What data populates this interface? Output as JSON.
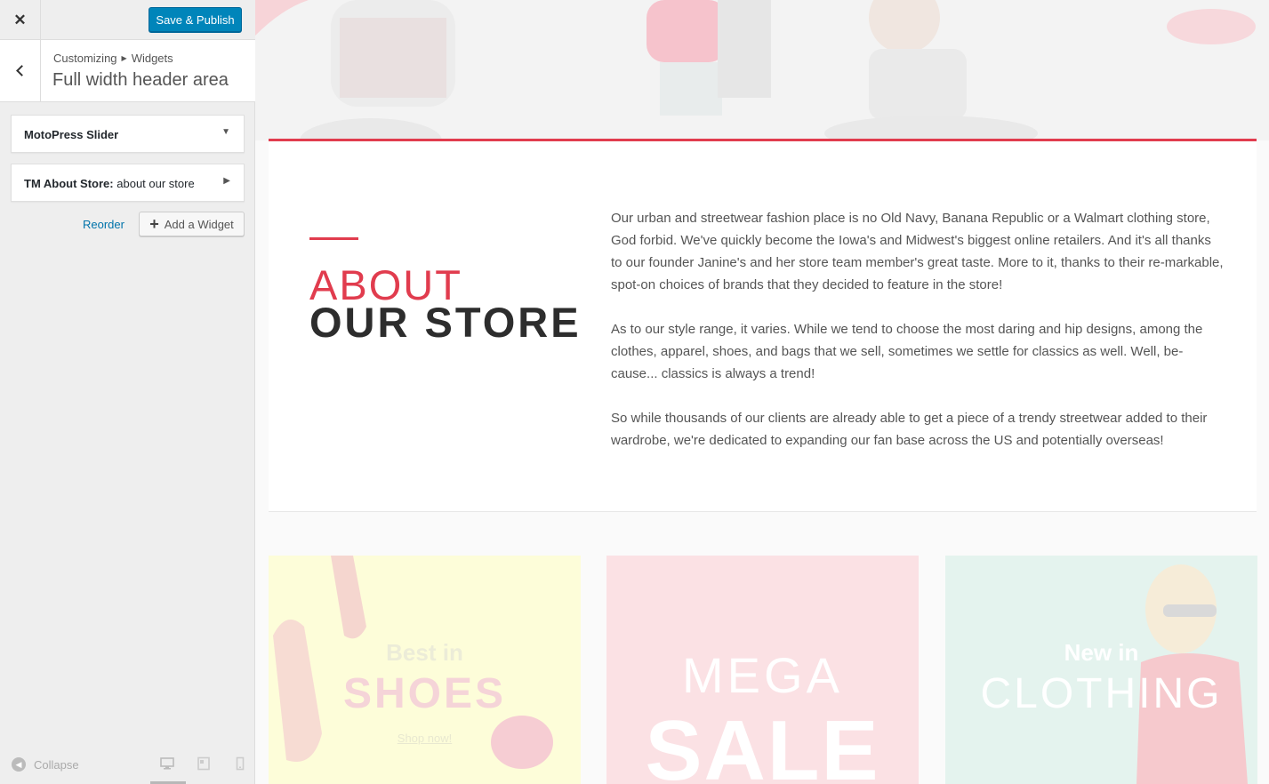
{
  "sidebar": {
    "close_icon": "close-icon",
    "publish_label": "Save & Publish",
    "breadcrumb": {
      "parent": "Customizing",
      "child": "Widgets"
    },
    "section_title": "Full width header area",
    "widgets": [
      {
        "name": "MotoPress Slider",
        "subtitle": ""
      },
      {
        "name": "TM About Store:",
        "subtitle": "about our store"
      }
    ],
    "reorder_label": "Reorder",
    "add_widget_label": "Add a Widget",
    "collapse_label": "Collapse",
    "devices": [
      "desktop-icon",
      "tablet-icon",
      "mobile-icon"
    ],
    "accent_color": "#0085ba"
  },
  "preview": {
    "accent_color": "#e13c4e",
    "about": {
      "title_line1": "ABOUT",
      "title_line2": "OUR STORE",
      "paragraphs": [
        "Our urban and streetwear fashion place is no Old Navy, Banana Republic or a Walmart clothing store, God forbid. We've quickly become the Iowa's and Midwest's biggest online retailers. And it's all thanks to our founder Janine's and her store team member's great taste. More to it, thanks to their re-markable, spot-on choices of brands that they decided to feature in the store!",
        "As to our style range, it varies. While we tend to choose the most daring and hip designs, among the clothes, apparel, shoes, and bags that we sell, sometimes we settle for classics as well. Well, be-cause... classics is always a trend!",
        "So while thousands of our clients are already able to get a piece of a trendy streetwear added to their wardrobe, we're dedicated to expanding our fan base across the US and potentially overseas!"
      ]
    },
    "promos": [
      {
        "top": "Best in",
        "big": "SHOES",
        "link": "Shop now!"
      },
      {
        "top": "MEGA",
        "big": "SALE",
        "link": ""
      },
      {
        "top": "New in",
        "big": "CLOTHING",
        "link": ""
      }
    ]
  }
}
